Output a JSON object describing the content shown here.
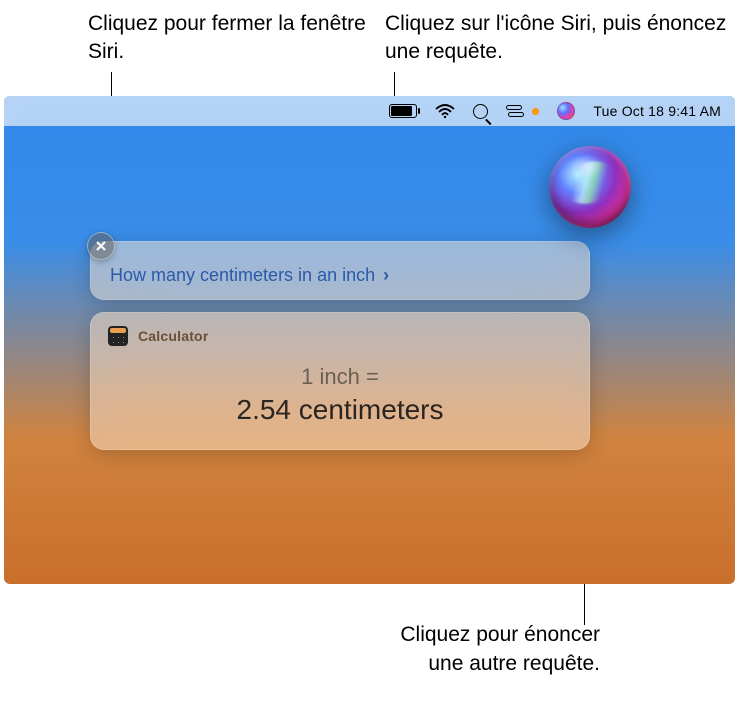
{
  "callouts": {
    "close": "Cliquez pour fermer la fenêtre Siri.",
    "menubar": "Cliquez sur l'icône Siri, puis énoncez une requête.",
    "orb": "Cliquez pour énoncer une autre requête."
  },
  "menubar": {
    "datetime": "Tue Oct 18  9:41 AM"
  },
  "siri": {
    "query": "How many centimeters in an inch",
    "result": {
      "app_name": "Calculator",
      "line1": "1 inch =",
      "line2": "2.54 centimeters"
    }
  }
}
